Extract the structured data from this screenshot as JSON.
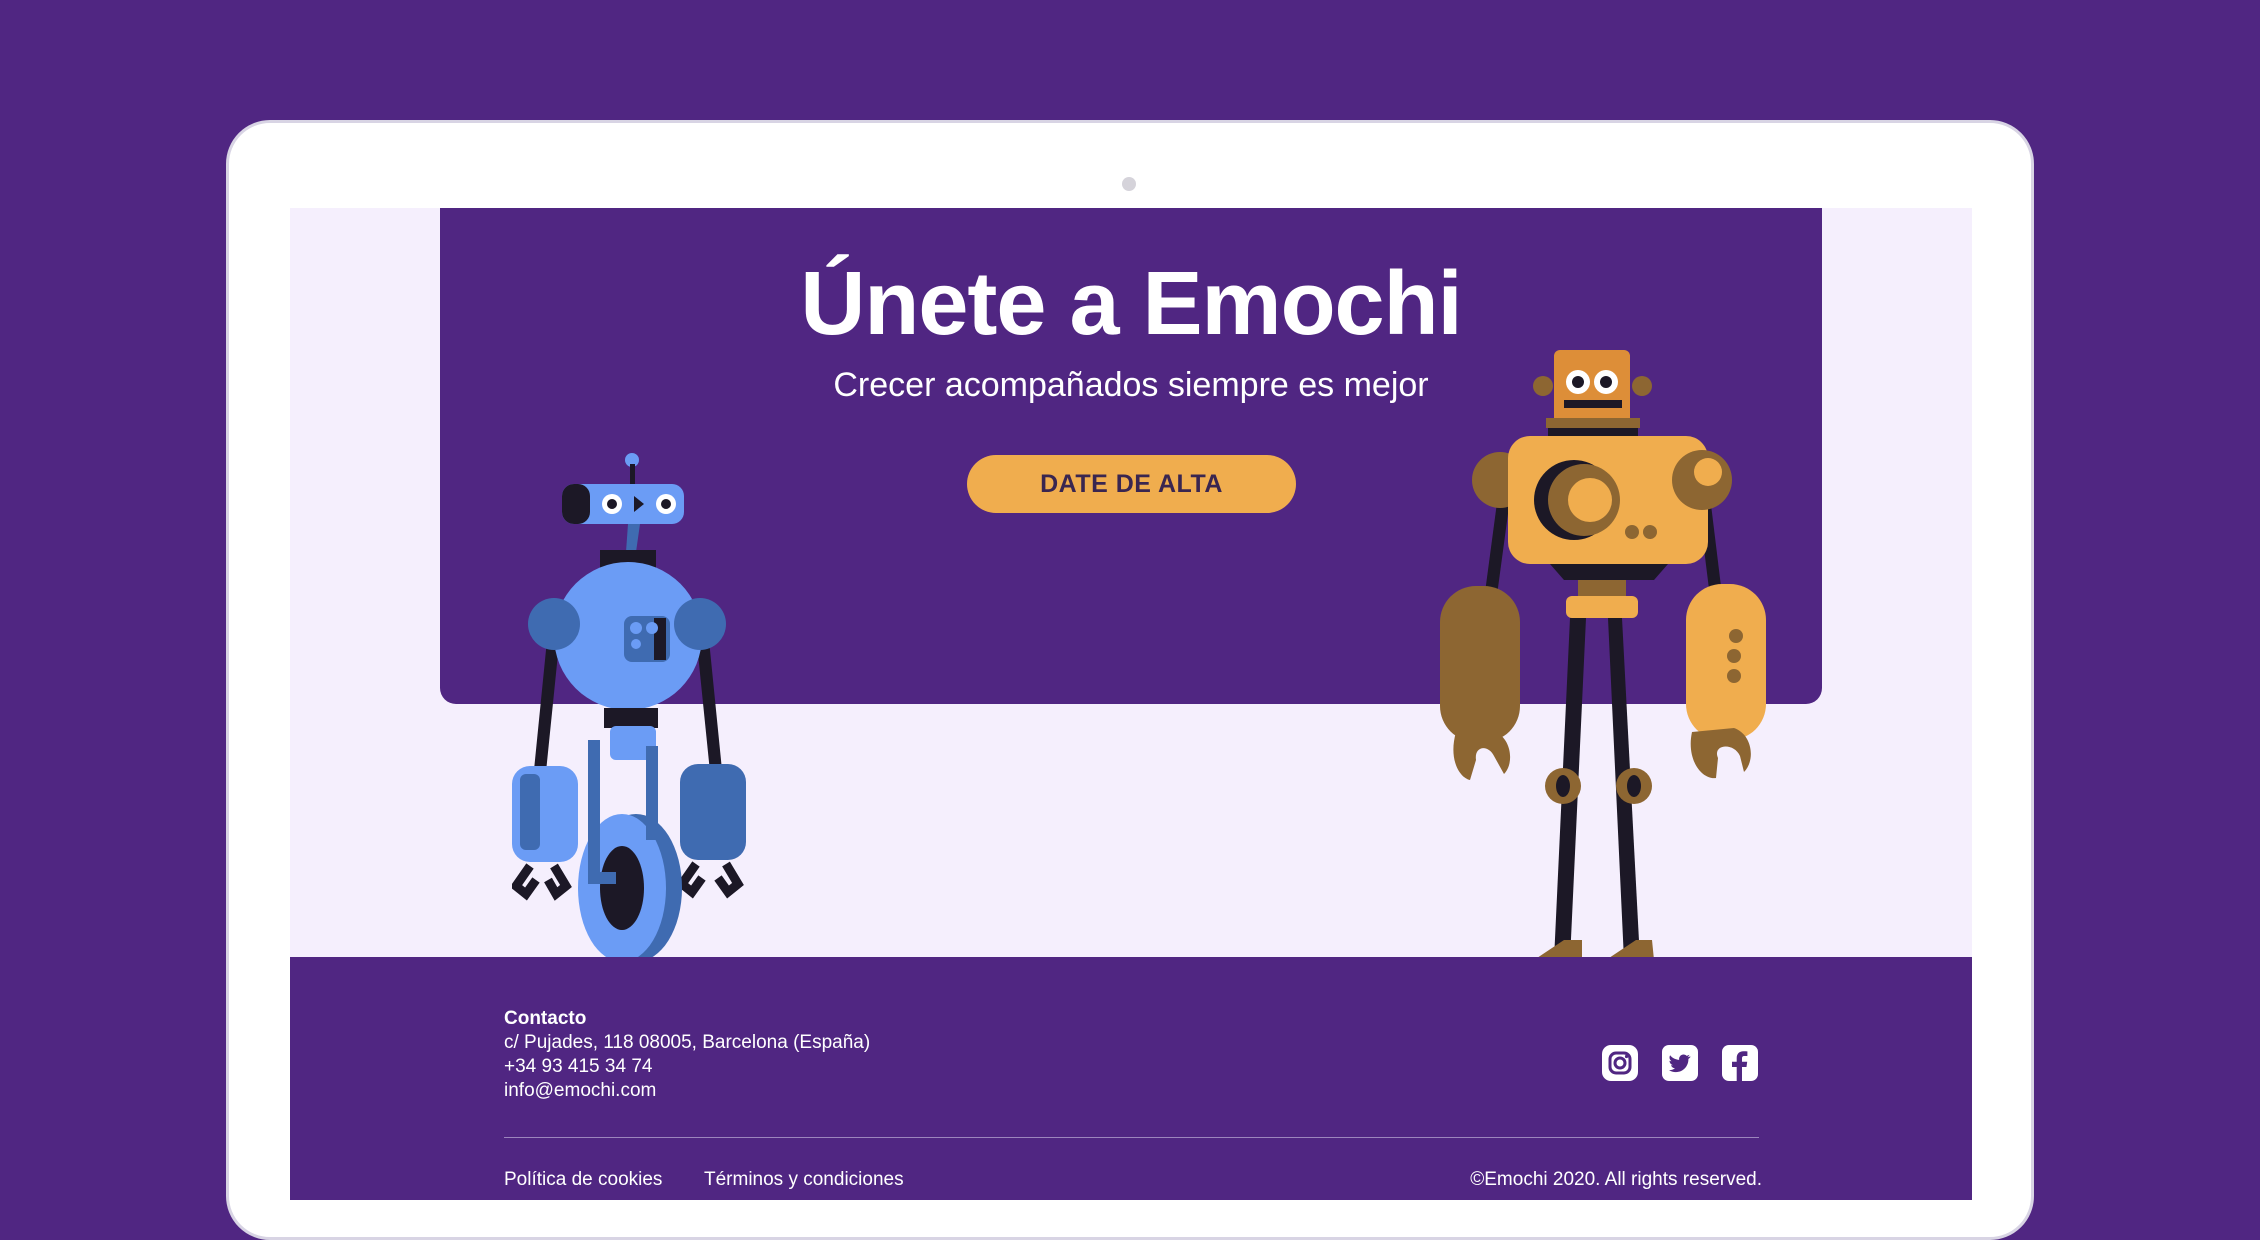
{
  "hero": {
    "title": "Únete a Emochi",
    "subtitle": "Crecer acompañados siempre es mejor",
    "cta_label": "DATE DE ALTA"
  },
  "footer": {
    "contact_heading": "Contacto",
    "address": "c/ Pujades, 118 08005, Barcelona (España)",
    "phone": "+34 93 415 34 74",
    "email": "info@emochi.com",
    "links": {
      "cookies": "Política de cookies",
      "terms": "Términos y condiciones"
    },
    "copyright": "©Emochi 2020. All rights reserved.",
    "social": [
      "instagram-icon",
      "twitter-icon",
      "facebook-icon"
    ]
  },
  "colors": {
    "brand_purple": "#502682",
    "accent_orange": "#f0ad4e",
    "screen_background": "#f5effd"
  }
}
